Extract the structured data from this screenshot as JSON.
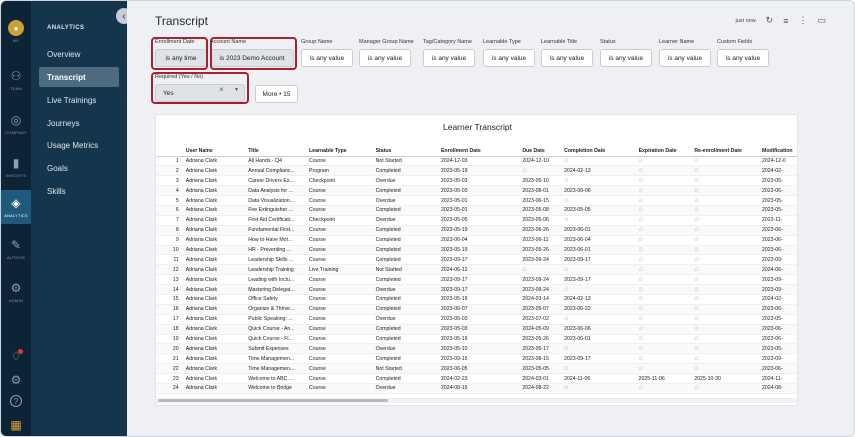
{
  "rail": {
    "items": [
      {
        "key": "me",
        "label": "ME",
        "icon": "avatar-icon"
      },
      {
        "key": "team",
        "label": "TEAM",
        "icon": "team-icon"
      },
      {
        "key": "company",
        "label": "COMPANY",
        "icon": "company-icon"
      },
      {
        "key": "insights",
        "label": "INSIGHTS",
        "icon": "bar-chart-icon"
      },
      {
        "key": "analytics",
        "label": "ANALYTICS",
        "icon": "analytics-icon"
      },
      {
        "key": "author",
        "label": "AUTHOR",
        "icon": "author-icon"
      },
      {
        "key": "admin",
        "label": "ADMIN",
        "icon": "admin-gear-icon"
      }
    ],
    "bottom": [
      {
        "icon": "notification-bell-icon"
      },
      {
        "icon": "settings-gear-icon"
      },
      {
        "icon": "help-icon"
      },
      {
        "icon": "app-grid-icon"
      }
    ]
  },
  "nav": {
    "title": "ANALYTICS",
    "items": [
      "Overview",
      "Transcript",
      "Live Trainings",
      "Journeys",
      "Usage Metrics",
      "Goals",
      "Skills"
    ],
    "active_index": 1
  },
  "header": {
    "title": "Transcript",
    "status": "just now",
    "icons": [
      "refresh-icon",
      "filter-icon",
      "more-icon",
      "folder-icon"
    ]
  },
  "filters": [
    {
      "label": "Enrollment Date",
      "value": "is any time"
    },
    {
      "label": "Account Name",
      "value": "is 2023 Demo Account"
    },
    {
      "label": "Group Name",
      "value": "is any value"
    },
    {
      "label": "Manager Group Name",
      "value": "is any value"
    },
    {
      "label": "Tag/Category Name",
      "value": "is any value"
    },
    {
      "label": "Learnable Type",
      "value": "is any value"
    },
    {
      "label": "Learnable Title",
      "value": "is any value"
    },
    {
      "label": "Status",
      "value": "is any value"
    },
    {
      "label": "Learner Name",
      "value": "is any value"
    },
    {
      "label": "Custom Fields",
      "value": "is any value"
    }
  ],
  "required_filter": {
    "label": "Required (Yes / No)",
    "value": "Yes",
    "clear": "×",
    "caret": "▾"
  },
  "more_button": "More • 15",
  "table": {
    "title": "Learner Transcript",
    "columns": [
      "",
      "User Name",
      "Title",
      "Learnable Type",
      "Status",
      "Enrollment Date",
      "Due Date",
      "Completion Date",
      "Expiration Date",
      "Re-enrollment Date",
      "Modification"
    ],
    "rows": [
      [
        "1",
        "Adriana Clark",
        "All Hands - Q4",
        "Course",
        "Not Started",
        "2024-12-03",
        "2024-12-10",
        "∅",
        "∅",
        "∅",
        "2024-12-0"
      ],
      [
        "2",
        "Adriana Clark",
        "Annual Complianc...",
        "Program",
        "Completed",
        "2023-05-19",
        "∅",
        "2024-02-13",
        "∅",
        "∅",
        "2024-02-"
      ],
      [
        "3",
        "Adriana Clark",
        "Career Drivers Ex...",
        "Checkpoint",
        "Overdue",
        "2023-05-03",
        "2023-05-10",
        "∅",
        "∅",
        "∅",
        "2023-05-"
      ],
      [
        "4",
        "Adriana Clark",
        "Data Analysis for ...",
        "Course",
        "Completed",
        "2023-05-03",
        "2023-08-01",
        "2023-06-06",
        "∅",
        "∅",
        "2023-06-"
      ],
      [
        "5",
        "Adriana Clark",
        "Data Visualization...",
        "Course",
        "Overdue",
        "2023-05-01",
        "2023-06-15",
        "∅",
        "∅",
        "∅",
        "2023-05-"
      ],
      [
        "6",
        "Adriana Clark",
        "Fire Extinguisher ...",
        "Course",
        "Completed",
        "2023-05-01",
        "2023-05-08",
        "2023-05-05",
        "∅",
        "∅",
        "2023-05-"
      ],
      [
        "7",
        "Adriana Clark",
        "First Aid Certificati...",
        "Checkpoint",
        "Overdue",
        "2023-05-05",
        "2023-05-06",
        "∅",
        "∅",
        "∅",
        "2023-11-"
      ],
      [
        "8",
        "Adriana Clark",
        "Fundamental First...",
        "Course",
        "Completed",
        "2023-05-19",
        "2023-06-26",
        "2023-06-01",
        "∅",
        "∅",
        "2023-06-"
      ],
      [
        "9",
        "Adriana Clark",
        "How to Have Mor...",
        "Course",
        "Completed",
        "2023-06-04",
        "2023-06-11",
        "2023-06-04",
        "∅",
        "∅",
        "2023-06-"
      ],
      [
        "10",
        "Adriana Clark",
        "HR - Preventing ...",
        "Course",
        "Completed",
        "2023-05-19",
        "2023-05-26",
        "2023-06-01",
        "∅",
        "∅",
        "2023-06-"
      ],
      [
        "11",
        "Adriana Clark",
        "Leadership Skills ...",
        "Course",
        "Completed",
        "2023-09-17",
        "2023-09-24",
        "2023-09-17",
        "∅",
        "∅",
        "2023-09-"
      ],
      [
        "12",
        "Adriana Clark",
        "Leadership Training",
        "Live Training",
        "Not Started",
        "2024-06-12",
        "∅",
        "∅",
        "∅",
        "∅",
        "2024-06-"
      ],
      [
        "13",
        "Adriana Clark",
        "Leading with Inclu...",
        "Course",
        "Completed",
        "2023-09-17",
        "2023-09-24",
        "2023-09-17",
        "∅",
        "∅",
        "2023-09-"
      ],
      [
        "14",
        "Adriana Clark",
        "Mastering Delegat...",
        "Course",
        "Overdue",
        "2023-09-17",
        "2023-09-24",
        "∅",
        "∅",
        "∅",
        "2023-09-"
      ],
      [
        "15",
        "Adriana Clark",
        "Office Safety",
        "Course",
        "Completed",
        "2023-05-19",
        "2024-03-14",
        "2024-02-13",
        "∅",
        "∅",
        "2024-02-"
      ],
      [
        "16",
        "Adriana Clark",
        "Organize & Thrive...",
        "Course",
        "Completed",
        "2023-06-07",
        "2023-05-07",
        "2023-06-22",
        "∅",
        "∅",
        "2023-06-"
      ],
      [
        "17",
        "Adriana Clark",
        "Public Speaking: ...",
        "Course",
        "Overdue",
        "2023-05-03",
        "2023-07-02",
        "∅",
        "∅",
        "∅",
        "2023-05-"
      ],
      [
        "18",
        "Adriana Clark",
        "Quick Course - An...",
        "Course",
        "Completed",
        "2023-05-03",
        "2024-05-09",
        "2023-06-06",
        "∅",
        "∅",
        "2023-06-"
      ],
      [
        "19",
        "Adriana Clark",
        "Quick Course - Fi...",
        "Course",
        "Completed",
        "2023-05-19",
        "2023-05-26",
        "2023-06-01",
        "∅",
        "∅",
        "2023-06-"
      ],
      [
        "20",
        "Adriana Clark",
        "Submit Expenses",
        "Course",
        "Overdue",
        "2023-05-10",
        "2023-05-17",
        "∅",
        "∅",
        "∅",
        "2023-05-"
      ],
      [
        "21",
        "Adriana Clark",
        "Time Managemen...",
        "Course",
        "Completed",
        "2023-09-15",
        "2023-08-15",
        "2023-09-17",
        "∅",
        "∅",
        "2023-09-"
      ],
      [
        "22",
        "Adriana Clark",
        "Time Managemen...",
        "Course",
        "Not Started",
        "2023-06-05",
        "2023-05-05",
        "∅",
        "∅",
        "∅",
        "2023-06-"
      ],
      [
        "23",
        "Adriana Clark",
        "Welcome to ABC ...",
        "Course",
        "Completed",
        "2024-02-23",
        "2024-03-01",
        "2024-11-06",
        "2025-11-06",
        "2025-10-30",
        "2024-11-"
      ],
      [
        "24",
        "Adriana Clark",
        "Welcome to Bridge",
        "Course",
        "Overdue",
        "2024-08-15",
        "2024-08-22",
        "∅",
        "∅",
        "∅",
        "2024-08-"
      ]
    ]
  }
}
